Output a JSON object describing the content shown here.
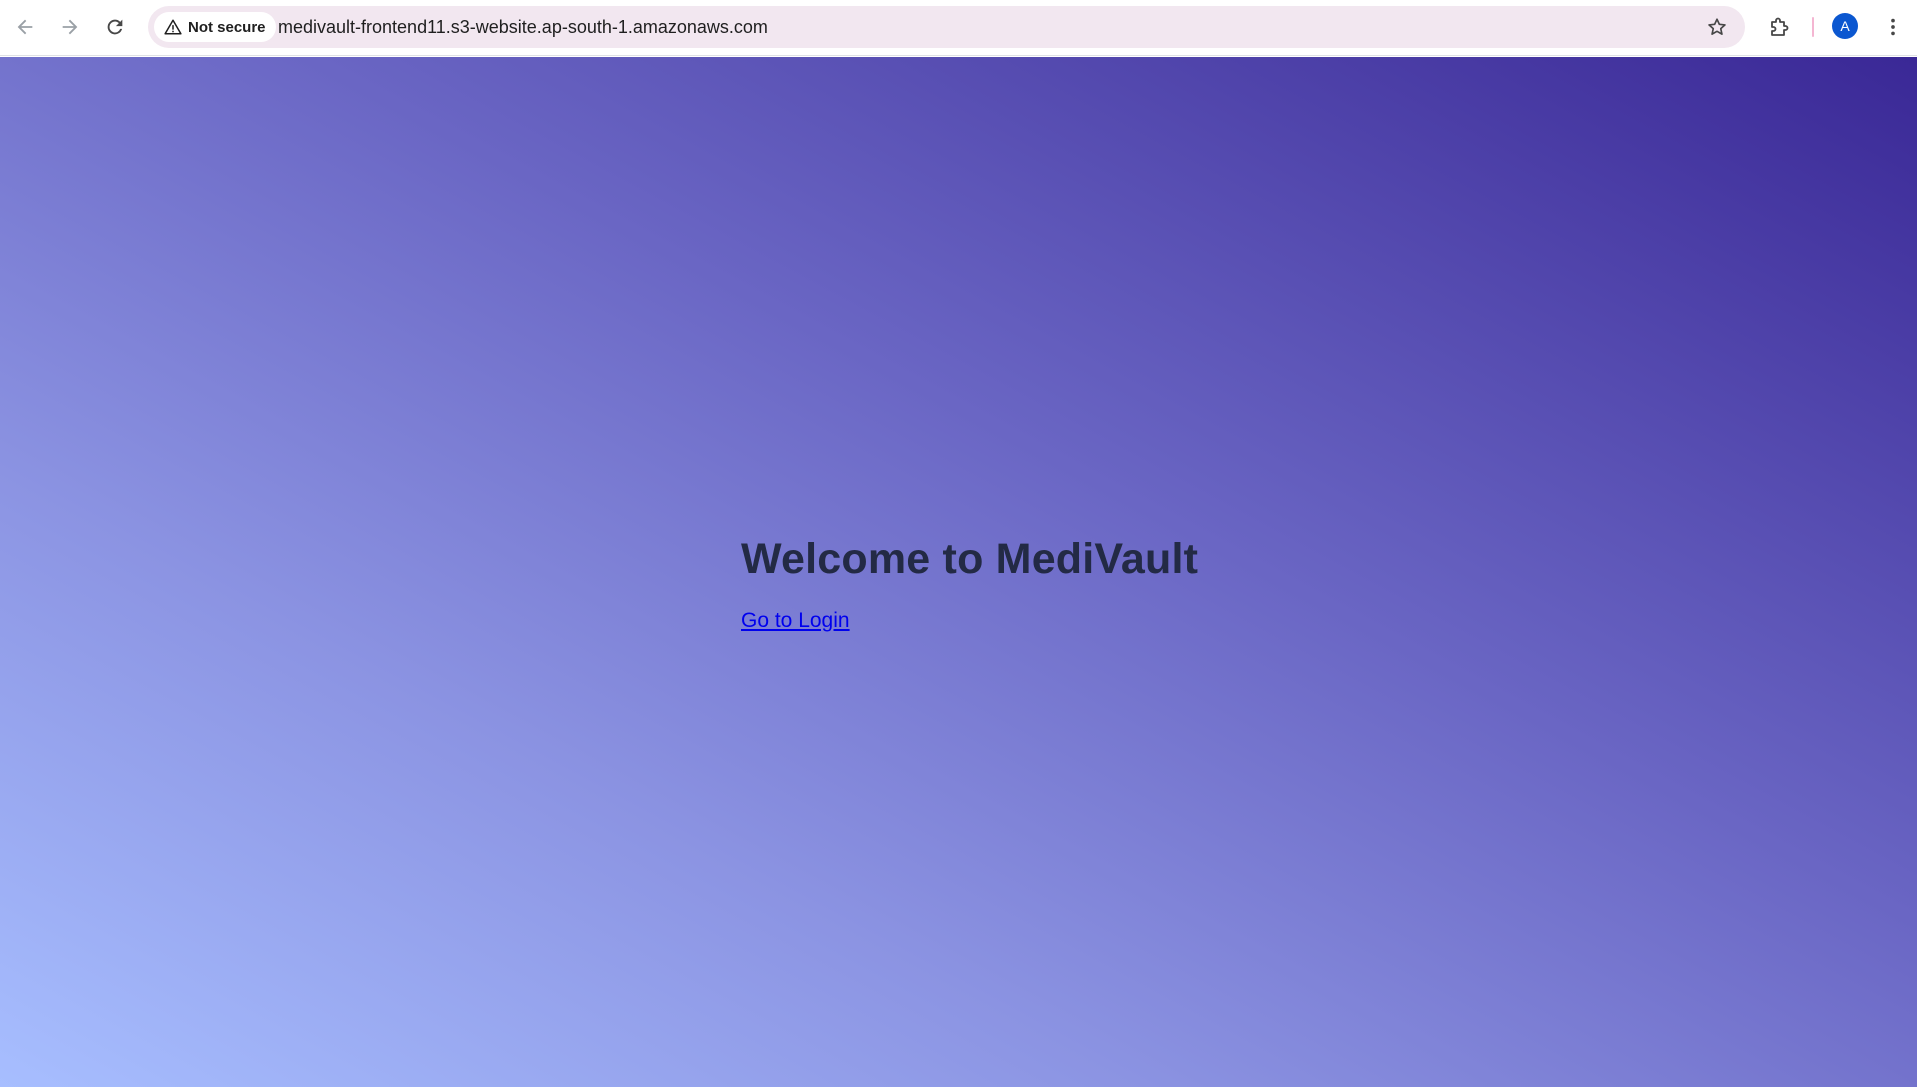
{
  "browser": {
    "back_icon": "arrow-left-icon",
    "forward_icon": "arrow-right-icon",
    "reload_icon": "reload-icon",
    "security": {
      "icon": "warning-triangle-icon",
      "label": "Not secure"
    },
    "url": "medivault-frontend11.s3-website.ap-south-1.amazonaws.com",
    "bookmark_icon": "star-outline-icon",
    "extensions_icon": "puzzle-icon",
    "profile_initial": "A",
    "menu_icon": "kebab-menu-icon"
  },
  "page": {
    "heading": "Welcome to MediVault",
    "login_link": "Go to Login"
  },
  "colors": {
    "gradient_start": "#a7beff",
    "gradient_end": "#3a2896",
    "heading": "#232a45",
    "link": "#0000ee",
    "omnibox_bg": "#f2e7f0",
    "avatar_bg": "#0b57d0"
  }
}
